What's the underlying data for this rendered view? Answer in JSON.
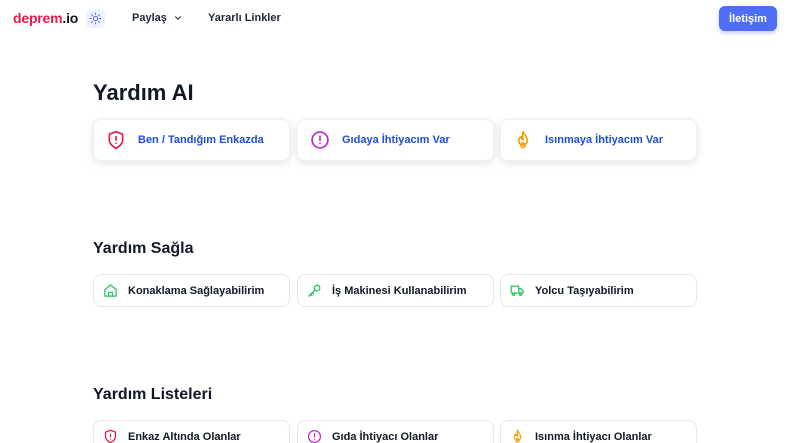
{
  "header": {
    "logo_part1": "deprem",
    "logo_part2": ".io",
    "theme_icon": "sun-icon",
    "nav": {
      "share_label": "Paylaş",
      "links_label": "Yararlı Linkler"
    },
    "contact_label": "İletişim"
  },
  "yardim_ai": {
    "title": "Yardım AI",
    "cards": [
      {
        "label": "Ben / Tandığım Enkazda",
        "icon": "shield-alert-icon",
        "color": "#e11d48"
      },
      {
        "label": "Gıdaya İhtiyacım Var",
        "icon": "alert-circle-icon",
        "color": "#c026d3"
      },
      {
        "label": "Isınmaya İhtiyacım Var",
        "icon": "flame-icon",
        "color": "#f59e0b"
      }
    ]
  },
  "yardim_sagla": {
    "title": "Yardım Sağla",
    "cards": [
      {
        "label": "Konaklama Sağlayabilirim",
        "icon": "home-icon",
        "color": "#22c55e"
      },
      {
        "label": "İş Makinesi Kullanabilirim",
        "icon": "key-icon",
        "color": "#22c55e"
      },
      {
        "label": "Yolcu Taşıyabilirim",
        "icon": "truck-icon",
        "color": "#22c55e"
      }
    ]
  },
  "yardim_listeleri": {
    "title": "Yardım Listeleri",
    "cards": [
      {
        "label": "Enkaz Altında Olanlar",
        "icon": "shield-alert-icon",
        "color": "#e11d48"
      },
      {
        "label": "Gıda İhtiyacı Olanlar",
        "icon": "alert-circle-icon",
        "color": "#c026d3"
      },
      {
        "label": "Isınma İhtiyacı Olanlar",
        "icon": "flame-icon",
        "color": "#f59e0b"
      }
    ]
  }
}
